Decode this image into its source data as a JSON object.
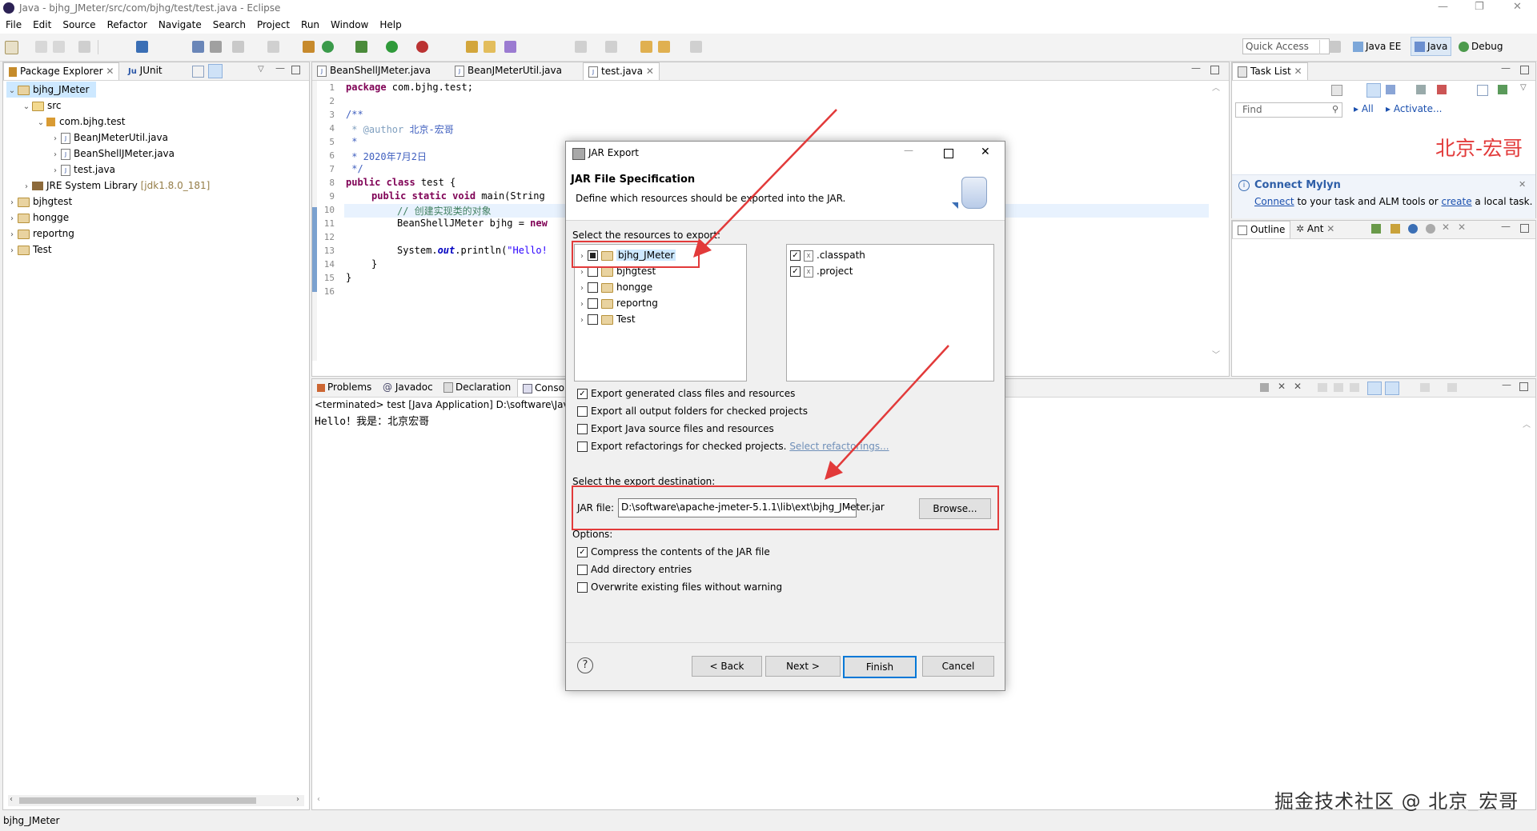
{
  "window": {
    "title": "Java - bjhg_JMeter/src/com/bjhg/test/test.java - Eclipse"
  },
  "menu": [
    "File",
    "Edit",
    "Source",
    "Refactor",
    "Navigate",
    "Search",
    "Project",
    "Run",
    "Window",
    "Help"
  ],
  "toolbar": {
    "quick_access": "Quick Access",
    "perspectives": [
      "Java EE",
      "Java",
      "Debug"
    ]
  },
  "left_panel": {
    "tabs": [
      "Package Explorer",
      "JUnit"
    ],
    "tree": {
      "project": "bjhg_JMeter",
      "src": "src",
      "package": "com.bjhg.test",
      "files": [
        "BeanJMeterUtil.java",
        "BeanShellJMeter.java",
        "test.java"
      ],
      "jre_label": "JRE System Library",
      "jre_version": "[jdk1.8.0_181]",
      "others": [
        "bjhgtest",
        "hongge",
        "reportng",
        "Test"
      ]
    }
  },
  "editor": {
    "tabs": [
      "BeanShellJMeter.java",
      "BeanJMeterUtil.java",
      "test.java"
    ],
    "line_numbers": [
      "1",
      "2",
      "3",
      "4",
      "5",
      "6",
      "7",
      "8",
      "9",
      "10",
      "11",
      "12",
      "13",
      "14",
      "15",
      "16"
    ],
    "lines": {
      "l1_kw": "package",
      "l1_rest": " com.bjhg.test;",
      "l3": "/**",
      "l4_tag": " * @author",
      "l4_rest": " 北京-宏哥",
      "l5": " *",
      "l6": " * 2020年7月2日",
      "l7": " */",
      "l8_kw": "public class",
      "l8_rest": " test {",
      "l9_kw": "public static void",
      "l9_rest": " main(String",
      "l10": "// 创建实现类的对象",
      "l11_a": "BeanShellJMeter bjhg = ",
      "l11_kw": "new",
      "l13_a": "System.",
      "l13_out": "out",
      "l13_b": ".println(",
      "l13_str": "\"Hello!",
      "l14": "}",
      "l15": "}"
    }
  },
  "right_panel": {
    "task_list_tab": "Task List",
    "find_placeholder": "Find",
    "all": "All",
    "activate": "Activate...",
    "watermark_red": "北京-宏哥",
    "mylyn": {
      "title": "Connect Mylyn",
      "connect": "Connect",
      "mid": " to your task and ALM tools or ",
      "create": "create",
      "end": " a local task."
    },
    "outline_tabs": [
      "Outline",
      "Ant"
    ]
  },
  "bottom_panel": {
    "tabs": [
      "Problems",
      "Javadoc",
      "Declaration",
      "Consol"
    ],
    "terminated": "<terminated> test [Java Application] D:\\software\\Java",
    "output": "Hello！我是：北京宏哥"
  },
  "status_bar": {
    "text": "bjhg_JMeter"
  },
  "watermark": "掘金技术社区 @ 北京_宏哥",
  "dialog": {
    "title": "JAR Export",
    "heading": "JAR File Specification",
    "subheading": "Define which resources should be exported into the JAR.",
    "select_resources": "Select the resources to export:",
    "projects": [
      "bjhg_JMeter",
      "bjhgtest",
      "hongge",
      "reportng",
      "Test"
    ],
    "files": [
      ".classpath",
      ".project"
    ],
    "export_options": [
      {
        "label": "Export generated class files and resources",
        "checked": true
      },
      {
        "label": "Export all output folders for checked projects",
        "checked": false
      },
      {
        "label": "Export Java source files and resources",
        "checked": false
      },
      {
        "label": "Export refactorings for checked projects.",
        "checked": false
      }
    ],
    "select_refactorings": "Select refactorings...",
    "destination_label": "Select the export destination:",
    "jar_file_label": "JAR file:",
    "jar_file_value": "D:\\software\\apache-jmeter-5.1.1\\lib\\ext\\bjhg_JMeter.jar",
    "browse": "Browse...",
    "options_label": "Options:",
    "options": [
      {
        "label": "Compress the contents of the JAR file",
        "checked": true
      },
      {
        "label": "Add directory entries",
        "checked": false
      },
      {
        "label": "Overwrite existing files without warning",
        "checked": false
      }
    ],
    "buttons": {
      "back": "< Back",
      "next": "Next >",
      "finish": "Finish",
      "cancel": "Cancel"
    },
    "help": "?"
  },
  "colors": {
    "annotation_red": "#e23a3a",
    "selection": "#cde8ff",
    "accent": "#0078d7"
  }
}
